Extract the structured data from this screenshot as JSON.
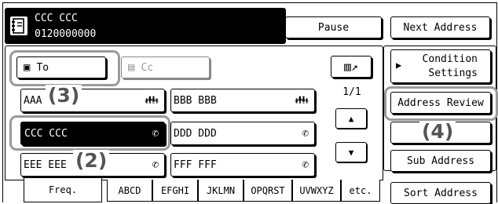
{
  "header": {
    "recipient_name": "CCC CCC",
    "recipient_number": "0120000000",
    "pause_label": "Pause",
    "next_address_label": "Next Address"
  },
  "recipient_type": {
    "to_label": "To",
    "cc_label": "Cc"
  },
  "right_panel": {
    "condition_settings_line1": "Condition",
    "condition_settings_line2": "Settings",
    "address_review_label": "Address Review",
    "sub_address_label": "Sub Address",
    "sort_address_label": "Sort Address"
  },
  "paging": {
    "page_indicator": "1/1"
  },
  "entries": [
    {
      "name": "AAA",
      "type": "group-icon"
    },
    {
      "name": "BBB BBB",
      "type": "group-icon"
    },
    {
      "name": "CCC CCC",
      "type": "phone-icon",
      "selected": true
    },
    {
      "name": "DDD DDD",
      "type": "phone-icon"
    },
    {
      "name": "EEE EEE",
      "type": "phone-icon"
    },
    {
      "name": "FFF FFF",
      "type": "phone-icon"
    }
  ],
  "tabs": [
    "Freq.",
    "ABCD",
    "EFGHI",
    "JKLMN",
    "OPQRST",
    "UVWXYZ",
    "etc."
  ],
  "callouts": [
    "(3)",
    "(2)",
    "(4)"
  ]
}
